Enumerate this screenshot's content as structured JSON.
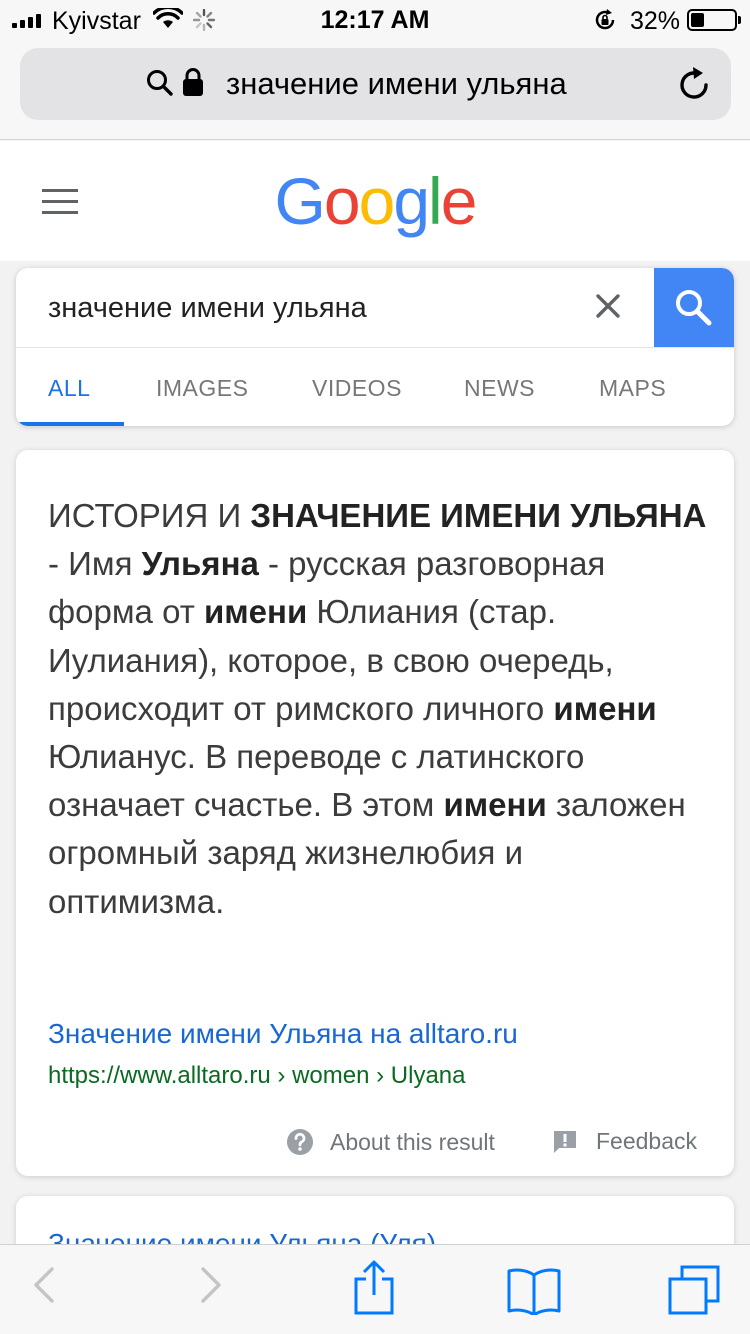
{
  "status": {
    "carrier": "Kyivstar",
    "time": "12:17 AM",
    "battery_pct": "32%",
    "battery_level": 0.32
  },
  "urlbar": {
    "text": "значение имени ульяна"
  },
  "google": {
    "logo_letters": [
      "G",
      "o",
      "o",
      "g",
      "l",
      "e"
    ],
    "query": "значение имени ульяна",
    "tabs": [
      "ALL",
      "IMAGES",
      "VIDEOS",
      "NEWS",
      "MAPS"
    ],
    "active_tab": "ALL"
  },
  "result": {
    "snippet_parts": [
      {
        "t": "ИСТОРИЯ И ",
        "b": false
      },
      {
        "t": "ЗНАЧЕНИЕ ИМЕНИ УЛЬЯНА",
        "b": true
      },
      {
        "t": " - Имя ",
        "b": false
      },
      {
        "t": "Ульяна",
        "b": true
      },
      {
        "t": " - русская разговорная форма от ",
        "b": false
      },
      {
        "t": "имени",
        "b": true
      },
      {
        "t": " Юлиания (стар. Иулиания), которое, в свою очередь, происходит от римского личного ",
        "b": false
      },
      {
        "t": "имени",
        "b": true
      },
      {
        "t": " Юлианус. В переводе с латинского означает счастье. В этом ",
        "b": false
      },
      {
        "t": "имени",
        "b": true
      },
      {
        "t": " заложен огромный заряд жизнелюбия и оптимизма.",
        "b": false
      }
    ],
    "title": "Значение имени Ульяна на alltaro.ru",
    "url": "https://www.alltaro.ru › women › Ulyana",
    "about_label": "About this result",
    "feedback_label": "Feedback"
  },
  "result2": {
    "title": "Значение имени Ульяна (Уля)"
  },
  "colors": {
    "google_blue": "#4285f4",
    "google_red": "#ea4335",
    "google_yellow": "#fbbc05",
    "google_green": "#34a853",
    "link": "#1967d2",
    "url_green": "#0b6a21",
    "ios_blue": "#007aff"
  },
  "icons": [
    "signal-icon",
    "wifi-icon",
    "activity-spinner-icon",
    "rotation-lock-icon",
    "battery-icon",
    "search-icon",
    "lock-icon",
    "reload-icon",
    "hamburger-menu-icon",
    "clear-icon",
    "back-icon",
    "forward-icon",
    "share-icon",
    "bookmarks-icon",
    "tabs-icon",
    "help-icon",
    "feedback-icon"
  ]
}
